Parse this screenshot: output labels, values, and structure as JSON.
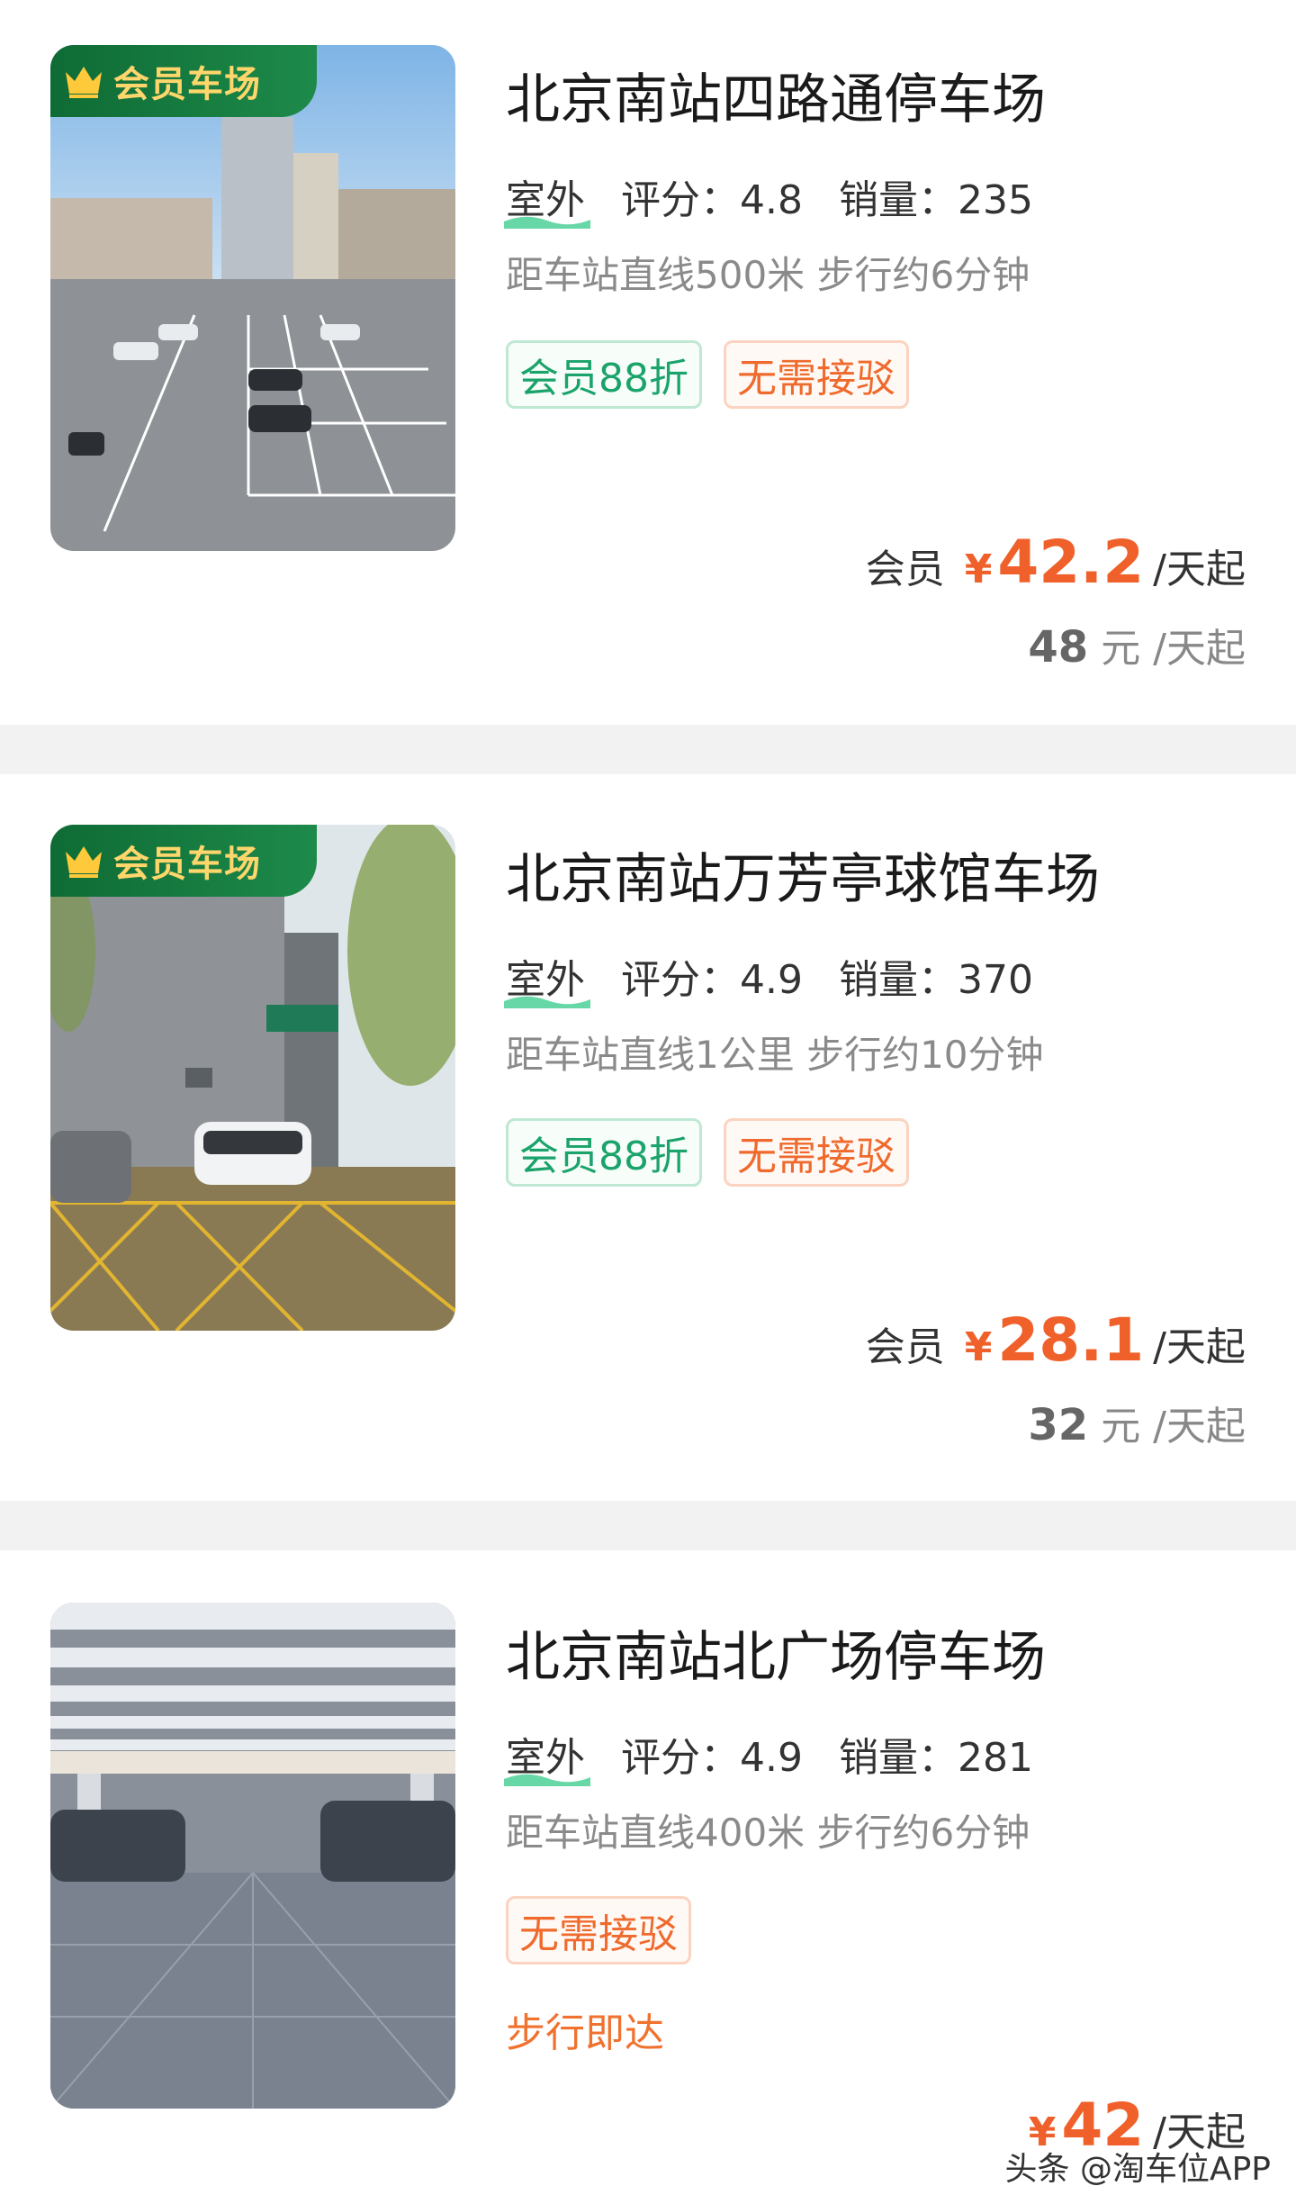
{
  "listings": [
    {
      "badge": "会员车场",
      "name": "北京南站四路通停车场",
      "type": "室外",
      "rating_label": "评分：4.8",
      "sales_label": "销量：235",
      "distance": "距车站直线500米 步行约6分钟",
      "tags": [
        "会员88折",
        "无需接驳"
      ],
      "member_label": "会员",
      "currency": "¥",
      "member_price": "42.2",
      "unit": "/天起",
      "original_price": "48",
      "original_unit": "元 /天起"
    },
    {
      "badge": "会员车场",
      "name": "北京南站万芳亭球馆车场",
      "type": "室外",
      "rating_label": "评分：4.9",
      "sales_label": "销量：370",
      "distance": "距车站直线1公里 步行约10分钟",
      "tags": [
        "会员88折",
        "无需接驳"
      ],
      "member_label": "会员",
      "currency": "¥",
      "member_price": "28.1",
      "unit": "/天起",
      "original_price": "32",
      "original_unit": "元 /天起"
    },
    {
      "name": "北京南站北广场停车场",
      "type": "室外",
      "rating_label": "评分：4.9",
      "sales_label": "销量：281",
      "distance": "距车站直线400米 步行约6分钟",
      "tags": [
        "无需接驳"
      ],
      "walk_note": "步行即达",
      "currency": "¥",
      "price": "42",
      "unit": "/天起"
    }
  ],
  "watermark": "头条 @淘车位APP",
  "colors": {
    "price": "#f0602a",
    "badge_bg": "#0f6b35",
    "badge_text": "#ffd66b",
    "tag_green": "#1aa36a",
    "tag_orange": "#ef6a2c",
    "divider": "#f2f2f2"
  },
  "icons": [
    "crown-icon"
  ]
}
